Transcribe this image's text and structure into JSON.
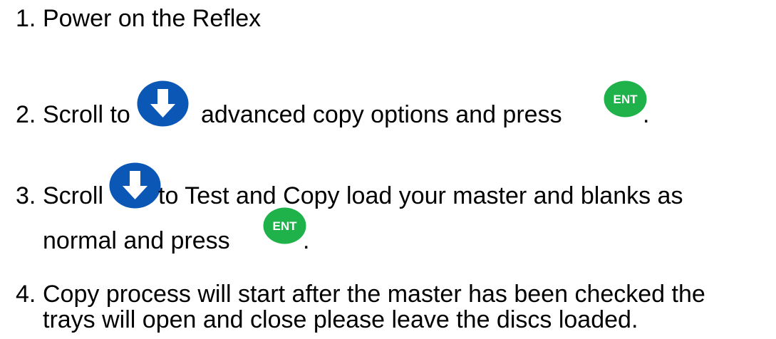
{
  "steps": [
    {
      "number": "1.",
      "text": "Power on the Reflex"
    },
    {
      "number": "2.",
      "text_before": "Scroll to",
      "icon_a": "down-arrow-circle-icon",
      "text_middle": "advanced copy options and press",
      "icon_b": "ent-button-icon",
      "text_after": "."
    },
    {
      "number": "3.",
      "text_before": "Scroll",
      "icon_a": "down-arrow-circle-icon",
      "text_middle": "to Test and Copy load your master and blanks as",
      "line2_before": "normal  and press",
      "icon_b": "ent-button-icon",
      "text_after": "."
    },
    {
      "number": "4.",
      "line1": "Copy process will start after the master has been checked the",
      "line2": "trays will open and close please leave the discs loaded."
    }
  ],
  "icons": {
    "ent_label": "ENT",
    "arrow_color": "#0a57b6",
    "ent_color": "#1fb24a"
  }
}
